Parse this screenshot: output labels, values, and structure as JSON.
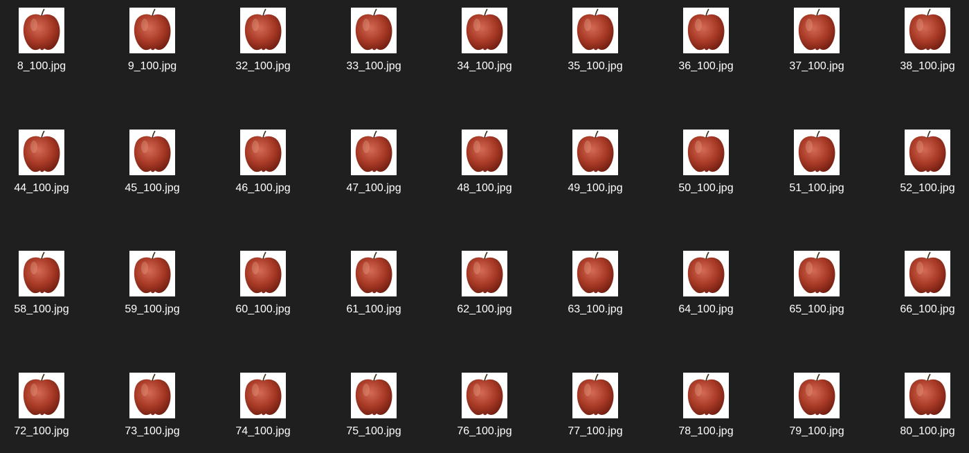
{
  "view": "large-icons",
  "background_color": "#1f1f1f",
  "files": [
    {
      "name": "8_100.jpg",
      "thumbnail": "red-apple"
    },
    {
      "name": "9_100.jpg",
      "thumbnail": "red-apple"
    },
    {
      "name": "32_100.jpg",
      "thumbnail": "red-apple"
    },
    {
      "name": "33_100.jpg",
      "thumbnail": "red-apple"
    },
    {
      "name": "34_100.jpg",
      "thumbnail": "red-apple"
    },
    {
      "name": "35_100.jpg",
      "thumbnail": "red-apple"
    },
    {
      "name": "36_100.jpg",
      "thumbnail": "red-apple"
    },
    {
      "name": "37_100.jpg",
      "thumbnail": "red-apple"
    },
    {
      "name": "38_100.jpg",
      "thumbnail": "red-apple"
    },
    {
      "name": "44_100.jpg",
      "thumbnail": "red-apple"
    },
    {
      "name": "45_100.jpg",
      "thumbnail": "red-apple"
    },
    {
      "name": "46_100.jpg",
      "thumbnail": "red-apple"
    },
    {
      "name": "47_100.jpg",
      "thumbnail": "red-apple"
    },
    {
      "name": "48_100.jpg",
      "thumbnail": "red-apple"
    },
    {
      "name": "49_100.jpg",
      "thumbnail": "red-apple"
    },
    {
      "name": "50_100.jpg",
      "thumbnail": "red-apple"
    },
    {
      "name": "51_100.jpg",
      "thumbnail": "red-apple"
    },
    {
      "name": "52_100.jpg",
      "thumbnail": "red-apple"
    },
    {
      "name": "58_100.jpg",
      "thumbnail": "red-apple"
    },
    {
      "name": "59_100.jpg",
      "thumbnail": "red-apple"
    },
    {
      "name": "60_100.jpg",
      "thumbnail": "red-apple"
    },
    {
      "name": "61_100.jpg",
      "thumbnail": "red-apple"
    },
    {
      "name": "62_100.jpg",
      "thumbnail": "red-apple"
    },
    {
      "name": "63_100.jpg",
      "thumbnail": "red-apple"
    },
    {
      "name": "64_100.jpg",
      "thumbnail": "red-apple"
    },
    {
      "name": "65_100.jpg",
      "thumbnail": "red-apple"
    },
    {
      "name": "66_100.jpg",
      "thumbnail": "red-apple"
    },
    {
      "name": "72_100.jpg",
      "thumbnail": "red-apple"
    },
    {
      "name": "73_100.jpg",
      "thumbnail": "red-apple"
    },
    {
      "name": "74_100.jpg",
      "thumbnail": "red-apple"
    },
    {
      "name": "75_100.jpg",
      "thumbnail": "red-apple"
    },
    {
      "name": "76_100.jpg",
      "thumbnail": "red-apple"
    },
    {
      "name": "77_100.jpg",
      "thumbnail": "red-apple"
    },
    {
      "name": "78_100.jpg",
      "thumbnail": "red-apple"
    },
    {
      "name": "79_100.jpg",
      "thumbnail": "red-apple"
    },
    {
      "name": "80_100.jpg",
      "thumbnail": "red-apple"
    }
  ]
}
